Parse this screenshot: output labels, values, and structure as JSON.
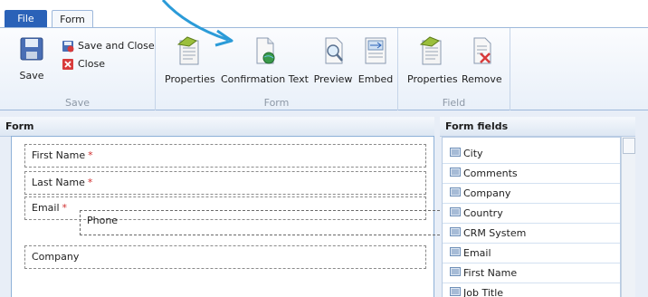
{
  "tabs": [
    {
      "label": "File"
    },
    {
      "label": "Form"
    }
  ],
  "ribbon": {
    "save_group": {
      "label": "Save",
      "save": "Save",
      "save_and_close": "Save and Close",
      "close": "Close"
    },
    "form_group": {
      "label": "Form",
      "properties": "Properties",
      "confirmation_text": "Confirmation Text",
      "preview": "Preview",
      "embed": "Embed"
    },
    "field_group": {
      "label": "Field",
      "properties": "Properties",
      "remove": "Remove"
    }
  },
  "form_panel": {
    "title": "Form",
    "fields": [
      {
        "label": "First Name",
        "required": "*"
      },
      {
        "label": "Last Name",
        "required": "*"
      },
      {
        "label": "Email",
        "required": "*"
      },
      {
        "label": "Company",
        "required": ""
      }
    ],
    "dragging_field": "Phone"
  },
  "fields_panel": {
    "title": "Form fields",
    "items": [
      "City",
      "Comments",
      "Company",
      "Country",
      "CRM System",
      "Email",
      "First Name",
      "Job Title"
    ]
  },
  "colors": {
    "file_tab": "#2a62b8",
    "required": "#d03030",
    "annotation_arrow": "#2b9bd8"
  }
}
